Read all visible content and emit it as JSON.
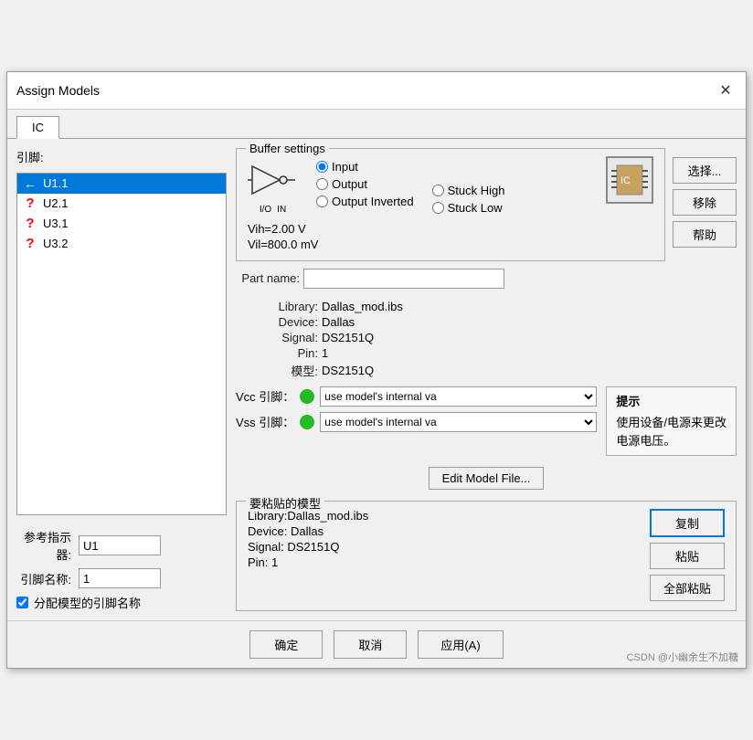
{
  "dialog": {
    "title": "Assign Models",
    "close_label": "✕"
  },
  "tabs": [
    {
      "label": "IC",
      "active": true
    }
  ],
  "buffer_settings": {
    "legend": "Buffer settings",
    "vih": "Vih=2.00 V",
    "vil": "Vil=800.0 mV",
    "radio_options": [
      {
        "id": "r_input",
        "label": "Input",
        "checked": true
      },
      {
        "id": "r_output",
        "label": "Output",
        "checked": false
      },
      {
        "id": "r_output_inv",
        "label": "Output Inverted",
        "checked": false
      }
    ],
    "radio_options_right": [
      {
        "id": "r_stuck_high",
        "label": "Stuck High",
        "checked": false
      },
      {
        "id": "r_stuck_low",
        "label": "Stuck Low",
        "checked": false
      }
    ]
  },
  "buttons_right": {
    "select": "选择...",
    "remove": "移除",
    "help": "帮助"
  },
  "part_name_label": "Part name:",
  "part_name_value": "",
  "part_name_placeholder": "",
  "info": {
    "library_label": "Library:",
    "library_value": "Dallas_mod.ibs",
    "device_label": "Device:",
    "device_value": "Dallas",
    "signal_label": "Signal:",
    "signal_value": "DS2151Q",
    "pin_label": "Pin:",
    "pin_value": "1",
    "model_label": "模型:",
    "model_value": "DS2151Q"
  },
  "vcc_vss": {
    "vcc_label": "Vcc 引脚：",
    "vss_label": "Vss 引脚：",
    "vcc_value": "use model's internal va",
    "vss_value": "use model's internal va",
    "options": [
      "use model's internal va"
    ]
  },
  "hint": {
    "title": "提示",
    "text": "使用设备/电源来更改\n电源电压。"
  },
  "edit_model_btn": "Edit Model File...",
  "paste_group": {
    "legend": "要粘贴的模型",
    "library": "Library:Dallas_mod.ibs",
    "device": "Device: Dallas",
    "signal": "Signal: DS2151Q",
    "pin": "Pin: 1"
  },
  "paste_buttons": {
    "copy": "复制",
    "paste": "粘贴",
    "paste_all": "全部粘贴"
  },
  "left_panel": {
    "pin_list_label": "引脚:",
    "pins": [
      {
        "id": "U1.1",
        "icon": "arrow",
        "selected": true
      },
      {
        "id": "U2.1",
        "icon": "question",
        "selected": false
      },
      {
        "id": "U3.1",
        "icon": "question",
        "selected": false
      },
      {
        "id": "U3.2",
        "icon": "question",
        "selected": false
      }
    ],
    "ref_label": "参考指示器:",
    "ref_value": "U1",
    "pin_name_label": "引脚名称:",
    "pin_name_value": "1",
    "checkbox_label": "分配模型的引脚名称"
  },
  "bottom_buttons": {
    "confirm": "确定",
    "cancel": "取消",
    "apply": "应用(A)"
  },
  "watermark": "CSDN @小幽余生不加糖"
}
